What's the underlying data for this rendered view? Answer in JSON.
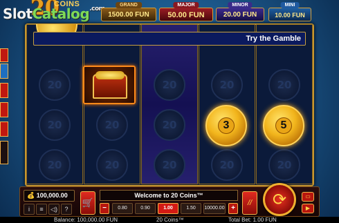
{
  "logo": {
    "number": "20",
    "word": "COINS"
  },
  "watermark": {
    "part1": "Slot",
    "part2": "Catalog",
    "suffix": ".com"
  },
  "jackpots": [
    {
      "name": "GRAND",
      "value": "1500.00 FUN"
    },
    {
      "name": "MAJOR",
      "value": "50.00 FUN"
    },
    {
      "name": "MINOR",
      "value": "20.00 FUN"
    },
    {
      "name": "MINI",
      "value": "10.00 FUN"
    }
  ],
  "message": "Try the Gamble",
  "reels": {
    "empty_coin_label": "20",
    "gold_coins": [
      {
        "label": "3"
      },
      {
        "label": "5"
      }
    ]
  },
  "panel": {
    "balance": "100,000.00",
    "balance_icon": "coin-bag-icon",
    "welcome": "Welcome to 20 Coins™",
    "bet_options": [
      "0.80",
      "0.90",
      "1.00",
      "1.50",
      "10000.00"
    ],
    "selected_bet": "1.00",
    "minus": "−",
    "plus": "+",
    "info_label": "i",
    "menu_label": "≡",
    "sound_label": "◁)",
    "help_label": "?"
  },
  "status": {
    "balance": "Balance: 100,000.00 FUN",
    "game": "20 Coins™",
    "total_bet": "Total Bet: 1.00 FUN"
  },
  "colors": {
    "accent": "#d41a14",
    "gold": "#f2b51c",
    "frame": "#c8962e"
  }
}
